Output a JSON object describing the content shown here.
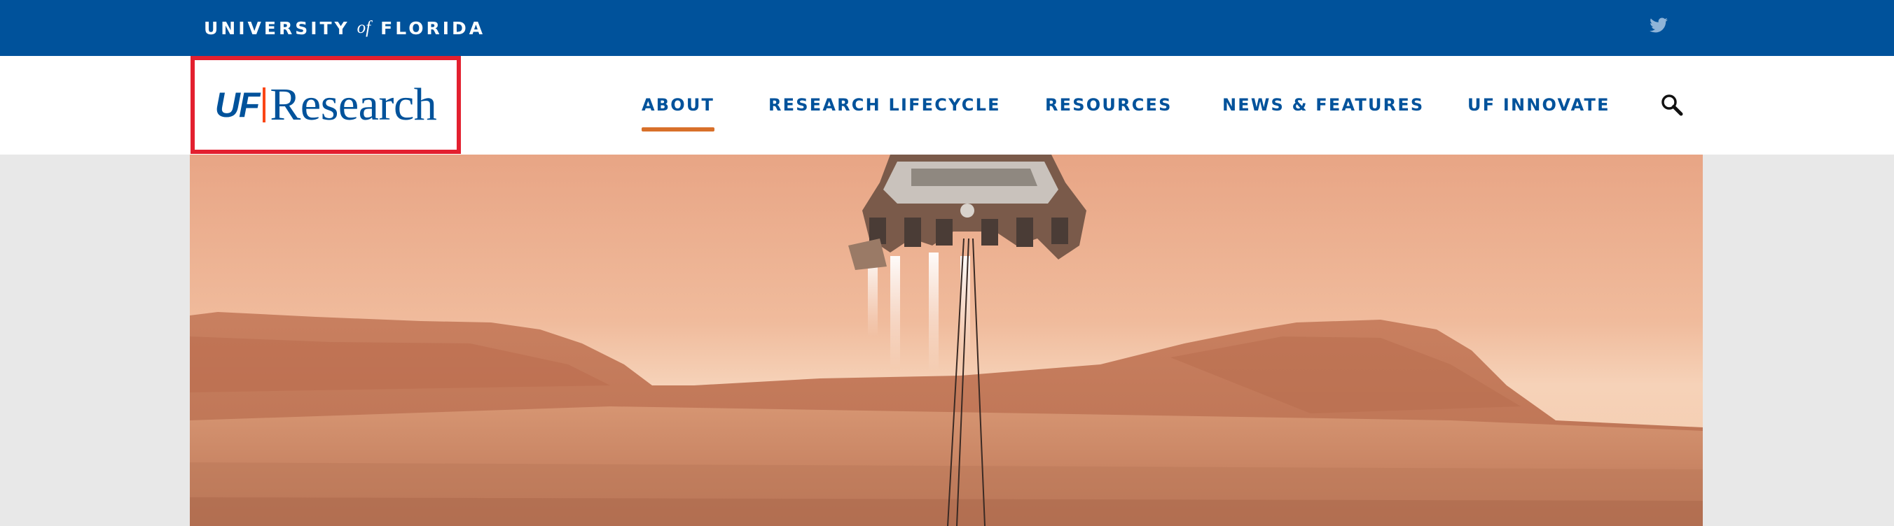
{
  "topbar": {
    "wordmark_left": "UNIVERSITY",
    "wordmark_of": "of",
    "wordmark_right": "FLORIDA",
    "social_icon": "twitter-icon",
    "background": "#00529b"
  },
  "logo": {
    "uf": "UF",
    "research": "Research",
    "highlight_color": "#e3202f"
  },
  "nav": {
    "items": [
      {
        "label": "ABOUT",
        "active": true
      },
      {
        "label": "RESEARCH LIFECYCLE",
        "active": false
      },
      {
        "label": "RESOURCES",
        "active": false
      },
      {
        "label": "NEWS & FEATURES",
        "active": false
      },
      {
        "label": "UF INNOVATE",
        "active": false
      }
    ],
    "search_icon": "search-icon",
    "text_color": "#00529b",
    "active_underline_color": "#d8702a"
  },
  "hero": {
    "image": "mars-landing-skycrane-illustration"
  }
}
